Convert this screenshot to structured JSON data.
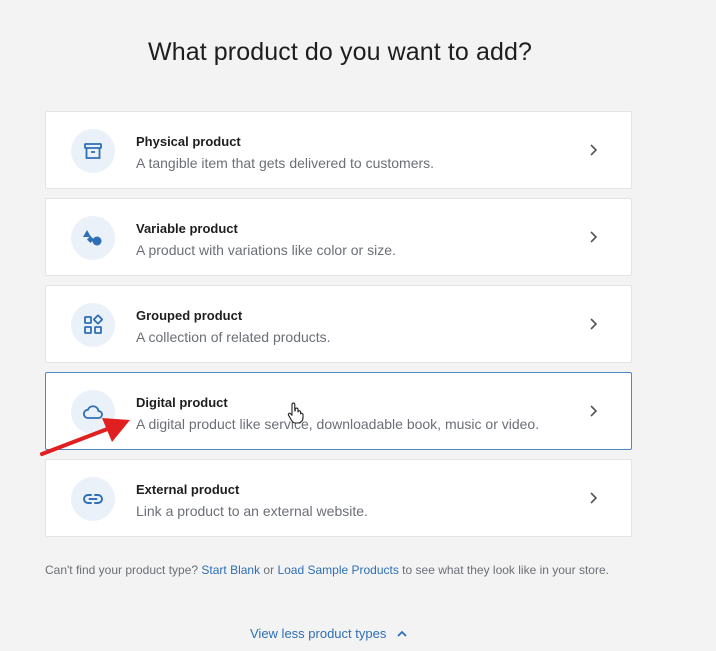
{
  "heading": "What product do you want to add?",
  "product_types": [
    {
      "title": "Physical product",
      "description": "A tangible item that gets delivered to customers.",
      "icon": "archive-box-icon"
    },
    {
      "title": "Variable product",
      "description": "A product with variations like color or size.",
      "icon": "shapes-icon"
    },
    {
      "title": "Grouped product",
      "description": "A collection of related products.",
      "icon": "grid-icon"
    },
    {
      "title": "Digital product",
      "description": "A digital product like service, downloadable book, music or video.",
      "icon": "cloud-icon"
    },
    {
      "title": "External product",
      "description": "Link a product to an external website.",
      "icon": "link-icon"
    }
  ],
  "footer": {
    "prefix": "Can't find your product type? ",
    "start_blank": "Start Blank",
    "or": " or ",
    "load_sample": "Load Sample Products",
    "suffix": " to see what they look like in your store."
  },
  "view_less_label": "View less product types",
  "colors": {
    "accent": "#2e6fb5",
    "icon_bg": "#eaf1f8",
    "hover_border": "#4f86c6",
    "annotation_arrow": "#e02020"
  }
}
